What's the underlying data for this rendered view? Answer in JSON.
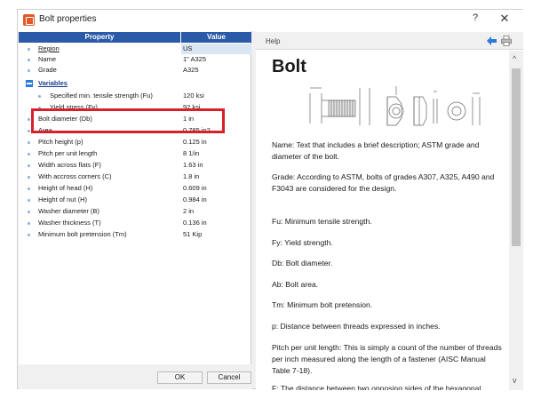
{
  "window": {
    "title": "Bolt properties",
    "help_button": "?",
    "close_button": "✕"
  },
  "grid": {
    "header_property": "Property",
    "header_value": "Value",
    "rows_top": [
      {
        "label": "Region",
        "value": "US"
      },
      {
        "label": "Name",
        "value": "1\" A325"
      },
      {
        "label": "Grade",
        "value": "A325"
      }
    ],
    "section_label": "Variables",
    "rows_vars": [
      {
        "label": "Specified min. tensile strength (Fu)",
        "value": "120 ksi"
      },
      {
        "label": "Yield stress (Fy)",
        "value": "92 ksi"
      },
      {
        "label": "Bolt diameter (Db)",
        "value": "1 in"
      },
      {
        "label": "Area",
        "value": "0.785 in2"
      },
      {
        "label": "Pitch height (p)",
        "value": "0.125 in"
      },
      {
        "label": "Pitch per unit length",
        "value": "8 1/in"
      },
      {
        "label": "Width across flats (F)",
        "value": "1.63 in"
      },
      {
        "label": "With accross corners (C)",
        "value": "1.8 in"
      },
      {
        "label": "Height of head (H)",
        "value": "0.609 in"
      },
      {
        "label": "Height of nut (H)",
        "value": "0.984 in"
      },
      {
        "label": "Washer diameter (B)",
        "value": "2 in"
      },
      {
        "label": "Washer thickness (T)",
        "value": "0.136 in"
      },
      {
        "label": "Minimum bolt pretension (Tm)",
        "value": "51 Kip"
      }
    ]
  },
  "buttons": {
    "ok": "OK",
    "cancel": "Cancel"
  },
  "help": {
    "label": "Help",
    "title": "Bolt",
    "paragraphs": [
      "Name: Text that includes a brief description; ASTM grade and diameter of the bolt.",
      "Grade: According to ASTM, bolts of grades A307, A325, A490 and F3043 are considered for the design.",
      "Fu: Minimum tensile strength.",
      "Fy: Yield strength.",
      "Db: Bolt diameter.",
      "Ab: Bolt area.",
      "Tm: Minimum bolt pretension.",
      "p: Distance between threads expressed in inches.",
      "Pitch per unit length: This is simply a count of the number of threads per inch measured along the length of a fastener (AISC Manual Table 7-18).",
      "F: The distance between two opposing sides of the hexagonal"
    ],
    "figure_labels": {
      "h": "H",
      "db": "Db",
      "b": "B",
      "t": "T"
    }
  },
  "colors": {
    "grid_header": "#2a5aa8",
    "highlight": "#d8202a",
    "accent_blue": "#2a7ad8"
  },
  "icons": [
    "bolt-app-icon",
    "back-arrow-icon",
    "print-icon",
    "collapse-minus-icon",
    "scroll-up-icon",
    "scroll-down-icon"
  ]
}
